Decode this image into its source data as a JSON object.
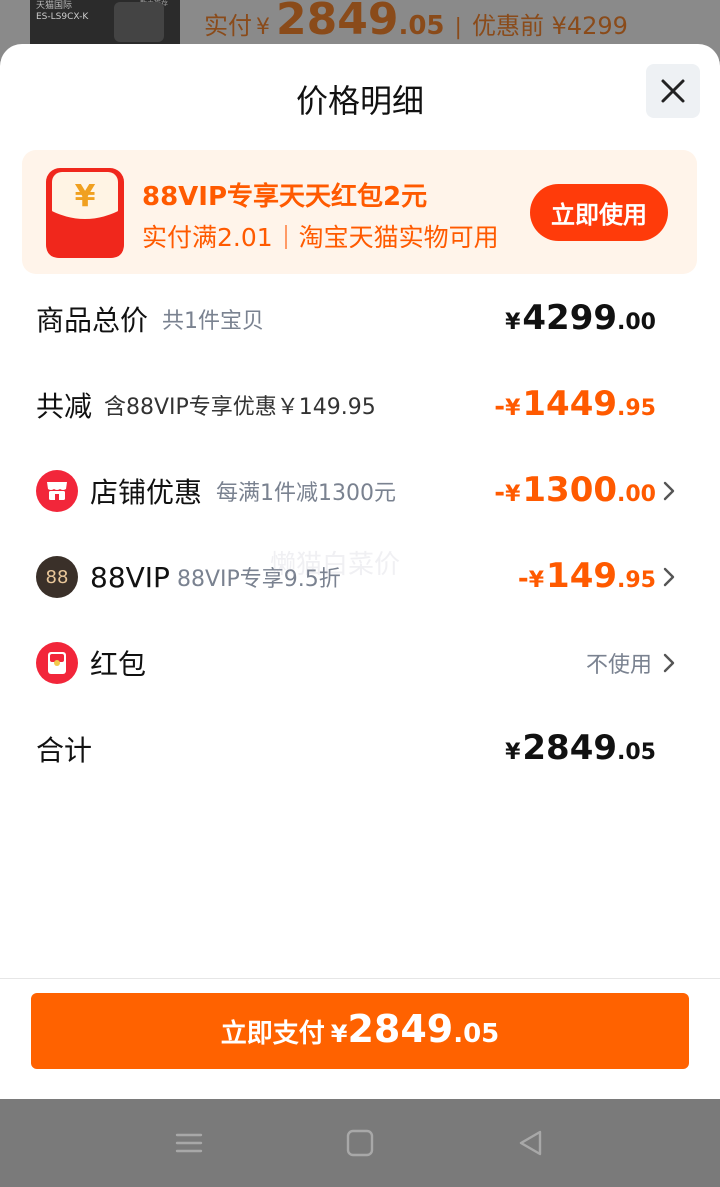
{
  "background": {
    "thumb_text_1": "天猫国际",
    "thumb_text_2": "ES-LS9CX-K",
    "thumb_tag": "新手推荐",
    "price_label": "实付",
    "currency": "¥",
    "price_int": "2849",
    "price_dec": ".05",
    "separator": "|",
    "before_label": "优惠前 ¥4299"
  },
  "sheet": {
    "title": "价格明细",
    "close_icon": "close-icon"
  },
  "promo": {
    "title": "88VIP专享天天红包2元",
    "sub_left": "实付满2.01",
    "sub_right": "淘宝天猫实物可用",
    "button_label": "立即使用",
    "icon": "red-envelope-yuan-icon"
  },
  "rows": {
    "total": {
      "label": "商品总价",
      "note": "共1件宝贝",
      "sign": "",
      "currency": "¥",
      "int": "4299",
      "dec": ".00"
    },
    "reduce": {
      "label": "共减",
      "note": "含88VIP专享优惠￥149.95",
      "sign": "-",
      "currency": "¥",
      "int": "1449",
      "dec": ".95"
    },
    "shop": {
      "label": "店铺优惠",
      "note": "每满1件减1300元",
      "sign": "-",
      "currency": "¥",
      "int": "1300",
      "dec": ".00",
      "icon": "shop-icon"
    },
    "vip": {
      "label": "88VIP",
      "note": "88VIP专享9.5折",
      "sign": "-",
      "currency": "¥",
      "int": "149",
      "dec": ".95",
      "icon_text": "88"
    },
    "redpacket": {
      "label": "红包",
      "value": "不使用",
      "icon": "red-packet-icon"
    },
    "sum": {
      "label": "合计",
      "currency": "¥",
      "int": "2849",
      "dec": ".05"
    }
  },
  "watermark": "懒猫白菜价",
  "footer": {
    "pay_label": "立即支付",
    "currency": "¥",
    "int": "2849",
    "dec": ".05"
  },
  "navbar": [
    "menu-icon",
    "home-square-icon",
    "back-triangle-icon"
  ],
  "colors": {
    "accent": "#ff5a00",
    "pay_button": "#ff6200",
    "promo_bg": "#fff4ea",
    "promo_button": "#ff3b0a"
  }
}
